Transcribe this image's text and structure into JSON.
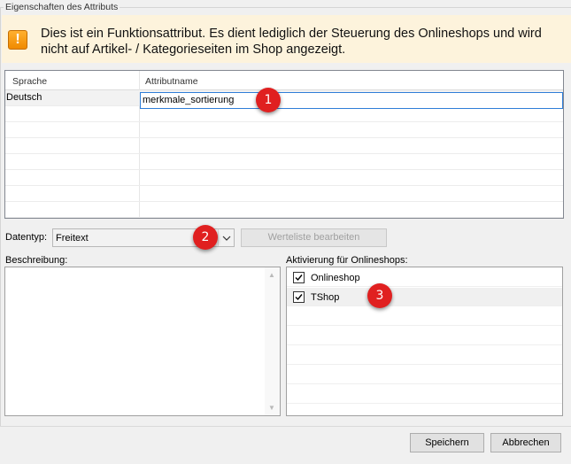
{
  "group": {
    "title": "Eigenschaften des Attributs"
  },
  "banner": {
    "icon": "warning-icon",
    "text": "Dies ist ein Funktionsattribut. Es dient lediglich der Steuerung des Onlineshops und wird nicht auf Artikel- / Kategorieseiten im Shop angezeigt."
  },
  "grid": {
    "headers": {
      "language": "Sprache",
      "name": "Attributname"
    },
    "rows": [
      {
        "language": "Deutsch",
        "name": "merkmale_sortierung"
      }
    ]
  },
  "datatype": {
    "label": "Datentyp:",
    "selected": "Freitext",
    "edit_values_button": "Werteliste bearbeiten"
  },
  "description": {
    "label": "Beschreibung:",
    "value": ""
  },
  "shops": {
    "label": "Aktivierung für Onlineshops:",
    "items": [
      {
        "name": "Onlineshop",
        "checked": true
      },
      {
        "name": "TShop",
        "checked": true
      }
    ]
  },
  "buttons": {
    "save": "Speichern",
    "cancel": "Abbrechen"
  },
  "markers": [
    "1",
    "2",
    "3"
  ],
  "colors": {
    "marker": "#e02020",
    "banner_bg": "#fdf3dc",
    "warning": "#f59c00",
    "focus": "#2f7ed8"
  }
}
